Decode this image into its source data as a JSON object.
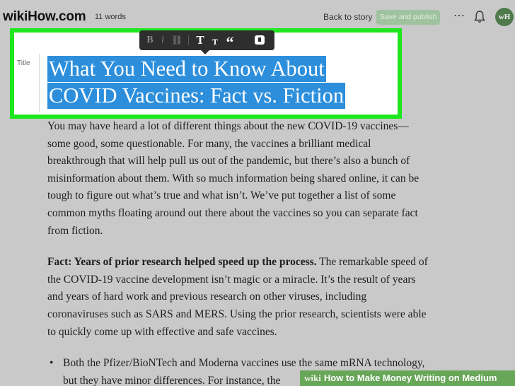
{
  "header": {
    "brand": "wikiHow.com",
    "word_count": "11 words",
    "back_link": "Back to story",
    "publish_button": "Save and publish",
    "more_icon": "more-horizontal-icon",
    "bell_icon": "bell-icon",
    "avatar_initials": "wH"
  },
  "toolbar": {
    "bold": "B",
    "italic": "i",
    "link": "⛓",
    "big_heading": "T",
    "small_heading": "T",
    "quote": "“",
    "note_icon": "private-note-icon"
  },
  "editor": {
    "title_label": "Title",
    "title_line1": "What You Need to Know About",
    "title_line2": "COVID Vaccines: Fact vs. Fiction",
    "intro": "You may have heard a lot of different things about the new COVID-19 vaccines—some good, some questionable. For many, the vaccines a brilliant medical breakthrough that will help pull us out of the pandemic, but there’s also a bunch of misinformation about them. With so much information being shared online, it can be tough to figure out what’s true and what isn’t. We’ve put together a list of some common myths floating around out there about the vaccines so you can separate fact from fiction.",
    "fact_heading": "Fact: Years of prior research helped speed up the process.",
    "fact_body": " The remarkable speed of the COVID-19 vaccine development isn’t magic or a miracle. It’s the result of years and years of hard work and previous research on other viruses, including coronaviruses such as SARS and MERS. Using the prior research, scientists were able to quickly come up with effective and safe vaccines.",
    "bullet1": "Both the Pfizer/BioNTech and Moderna vaccines use the same mRNA technology, but they have minor differences. For instance, the"
  },
  "watermark": {
    "logo": "wiki",
    "text": "How to Make Money Writing on Medium"
  },
  "colors": {
    "frame": "#1ee61e",
    "selection": "#2d8fdc",
    "publish": "#9fc39f"
  }
}
